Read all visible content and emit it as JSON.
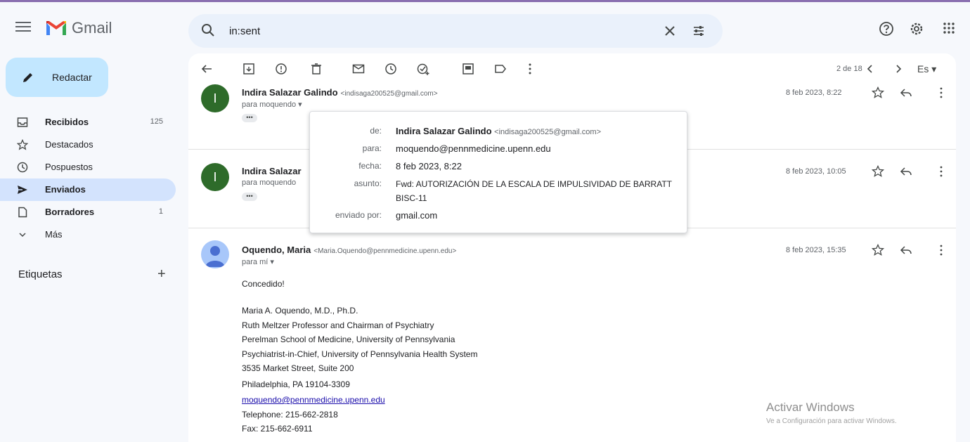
{
  "app": {
    "name": "Gmail"
  },
  "search": {
    "query": "in:sent"
  },
  "sidebar": {
    "compose_label": "Redactar",
    "items": [
      {
        "label": "Recibidos",
        "count": "125",
        "bold": true,
        "icon": "inbox-icon"
      },
      {
        "label": "Destacados",
        "count": "",
        "bold": false,
        "icon": "star-icon"
      },
      {
        "label": "Pospuestos",
        "count": "",
        "bold": false,
        "icon": "clock-icon"
      },
      {
        "label": "Enviados",
        "count": "",
        "bold": true,
        "icon": "send-icon"
      },
      {
        "label": "Borradores",
        "count": "1",
        "bold": true,
        "icon": "draft-icon"
      },
      {
        "label": "Más",
        "count": "",
        "bold": false,
        "icon": "chevron-down-icon"
      }
    ],
    "labels_title": "Etiquetas"
  },
  "toolbar": {
    "page_count": "2 de 18",
    "language": "Es"
  },
  "messages": [
    {
      "avatar": "I",
      "sender": "Indira Salazar Galindo",
      "sender_email": "<indisaga200525@gmail.com>",
      "to": "para moquendo",
      "date": "8 feb 2023, 8:22"
    },
    {
      "avatar": "I",
      "sender": "Indira Salazar",
      "to": "para moquendo",
      "date": "8 feb 2023, 10:05"
    },
    {
      "sender": "Oquendo, Maria",
      "sender_email": "<Maria.Oquendo@pennmedicine.upenn.edu>",
      "to": "para mí",
      "date": "8 feb 2023, 15:35",
      "body": {
        "greeting": "Concedido!",
        "sig": [
          "Maria A. Oquendo, M.D., Ph.D.",
          "Ruth Meltzer Professor and Chairman of Psychiatry",
          "Perelman School of Medicine, University of Pennsylvania",
          "Psychiatrist-in-Chief, University of Pennsylvania Health System",
          "3535 Market Street, Suite 200",
          "Philadelphia, PA 19104-3309"
        ],
        "email_link": "moquendo@pennmedicine.upenn.edu",
        "telephone": "Telephone: 215-662-2818",
        "fax": "Fax: 215-662-6911"
      }
    }
  ],
  "popup": {
    "de_key": "de:",
    "de_name": "Indira Salazar Galindo",
    "de_email": "<indisaga200525@gmail.com>",
    "para_key": "para:",
    "para_value": "moquendo@pennmedicine.upenn.edu",
    "fecha_key": "fecha:",
    "fecha_value": "8 feb 2023, 8:22",
    "asunto_key": "asunto:",
    "asunto_value": "Fwd: AUTORIZACIÓN DE LA ESCALA DE IMPULSIVIDAD DE BARRATT BISC-11",
    "enviado_key": "enviado por:",
    "enviado_value": "gmail.com"
  },
  "watermark": {
    "title": "Activar Windows",
    "subtitle": "Ve a Configuración para activar Windows."
  },
  "colors": {
    "accent": "#c2e7ff",
    "active_nav": "#d3e3fd",
    "search_bg": "#eaf1fb",
    "avatar_green": "#2e6b2a"
  }
}
